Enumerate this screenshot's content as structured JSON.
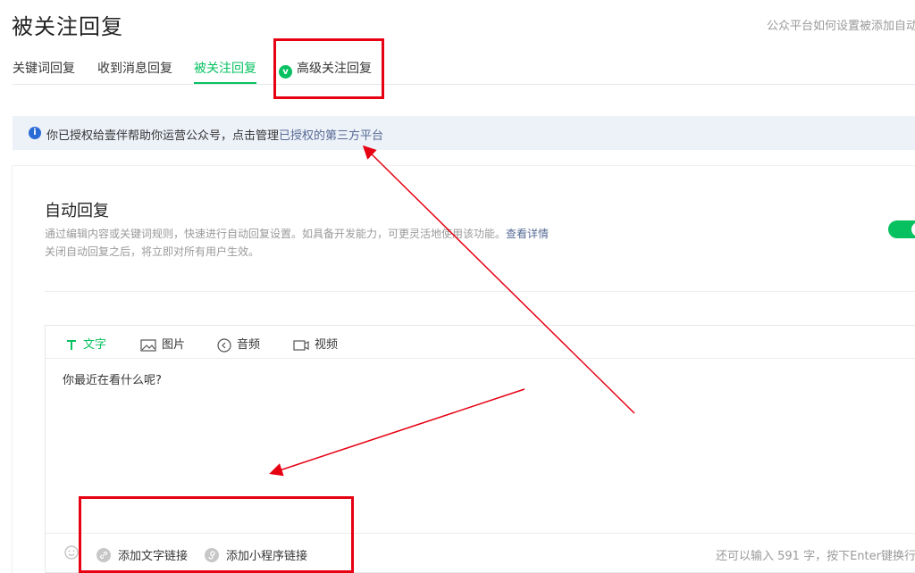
{
  "page": {
    "title": "被关注回复",
    "help_link": "公众平台如何设置被添加自动"
  },
  "tabs": [
    {
      "label": "关键词回复",
      "active": false
    },
    {
      "label": "收到消息回复",
      "active": false
    },
    {
      "label": "被关注回复",
      "active": true
    },
    {
      "label": "高级关注回复",
      "active": false,
      "badge": "v-badge-icon"
    }
  ],
  "notice": {
    "text": "你已授权给壹伴帮助你运营公众号，点击管理",
    "link": "已授权的第三方平台"
  },
  "auto_reply": {
    "title": "自动回复",
    "desc_line1": "通过编辑内容或关键词规则，快速进行自动回复设置。如具备开发能力，可更灵活地使用该功能。",
    "desc_link": "查看详情",
    "desc_line2": "关闭自动回复之后，将立即对所有用户生效。",
    "enabled": true
  },
  "editor": {
    "tools": [
      {
        "label": "文字",
        "icon": "text-icon",
        "active": true
      },
      {
        "label": "图片",
        "icon": "image-icon",
        "active": false
      },
      {
        "label": "音频",
        "icon": "audio-icon",
        "active": false
      },
      {
        "label": "视频",
        "icon": "video-icon",
        "active": false
      }
    ],
    "content": "你最近在看什么呢?",
    "footer": {
      "emoji_icon": "emoji-icon",
      "add_text_link": "添加文字链接",
      "add_miniprogram_link": "添加小程序链接",
      "counter": "还可以输入 591 字，按下Enter键换行"
    }
  },
  "colors": {
    "accent": "#07c160",
    "link": "#576b95",
    "annotation": "#e60012"
  }
}
